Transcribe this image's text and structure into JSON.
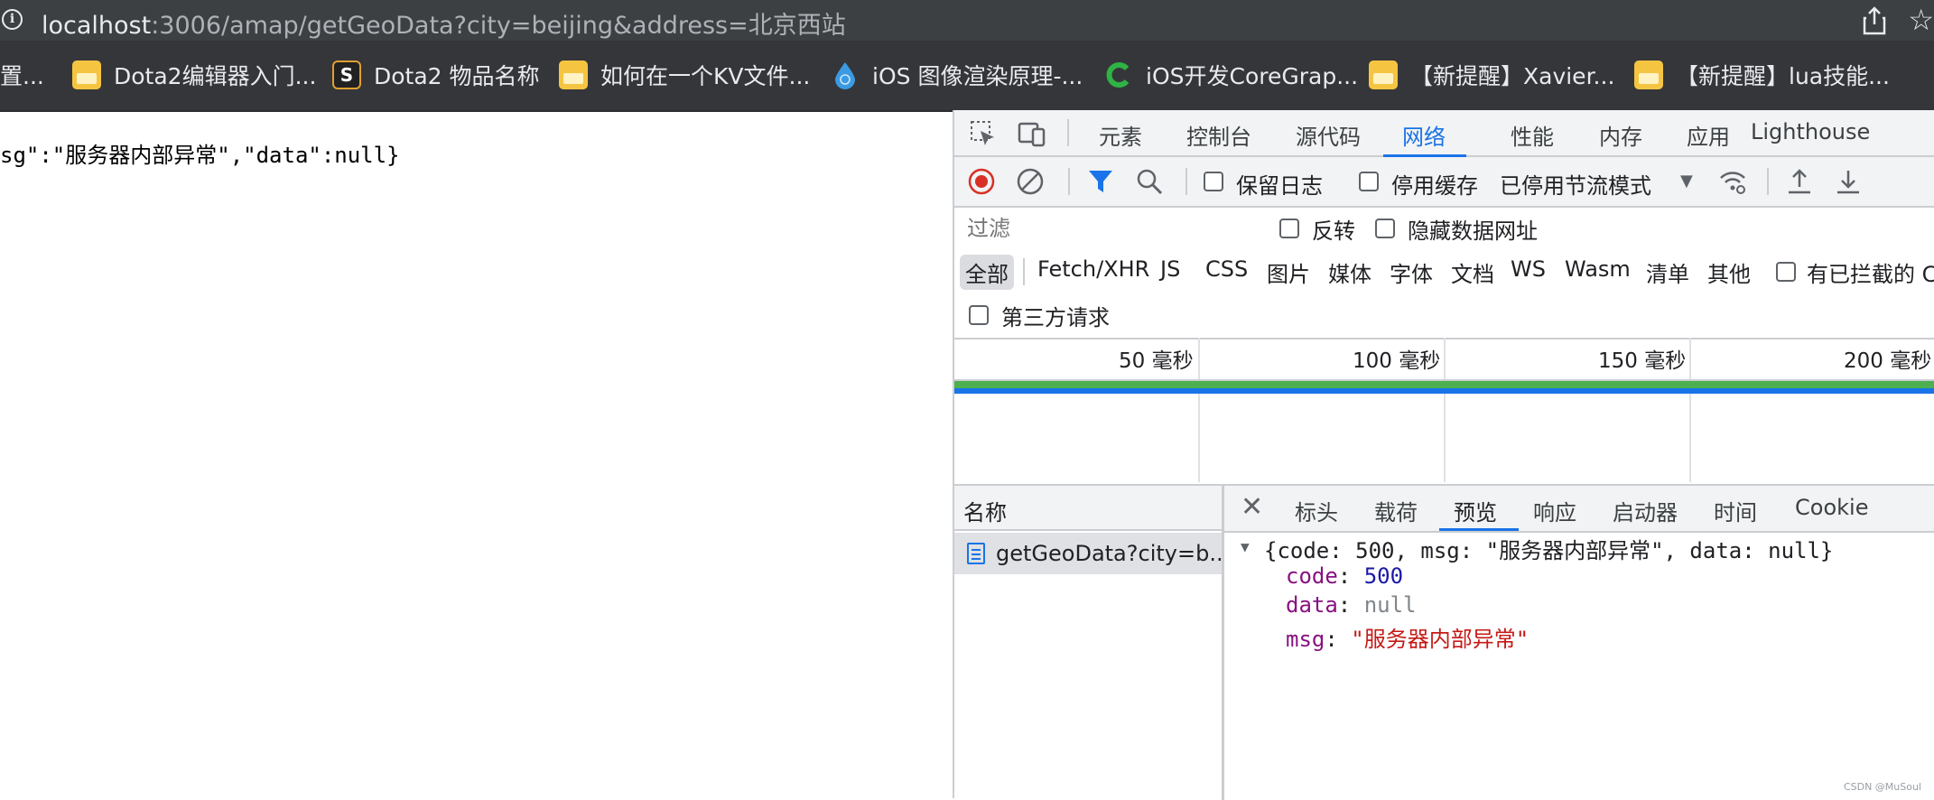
{
  "address_bar": {
    "host": "localhost",
    "path": ":3006/amap/getGeoData?city=beijing&address=北京西站"
  },
  "bookmarks": [
    {
      "label": "置...",
      "icon": "mail-icon"
    },
    {
      "label": "Dota2编辑器入门...",
      "icon": "mail-icon"
    },
    {
      "label": "Dota2 物品名称",
      "icon": "s-logo-icon"
    },
    {
      "label": "如何在一个KV文件...",
      "icon": "mail-icon"
    },
    {
      "label": "iOS 图像渲染原理-...",
      "icon": "drop-icon"
    },
    {
      "label": "iOS开发CoreGrap...",
      "icon": "c-logo-icon"
    },
    {
      "label": "【新提醒】Xavier...",
      "icon": "mail-icon"
    },
    {
      "label": "【新提醒】lua技能...",
      "icon": "mail-icon"
    }
  ],
  "page": {
    "body_text": "sg\":\"服务器内部异常\",\"data\":null}"
  },
  "devtools": {
    "tabs": [
      "元素",
      "控制台",
      "源代码",
      "网络",
      "性能",
      "内存",
      "应用",
      "Lighthouse"
    ],
    "active_tab": "网络",
    "toolbar": {
      "preserve_log": "保留日志",
      "disable_cache": "停用缓存",
      "throttling": "已停用节流模式"
    },
    "filter": {
      "placeholder": "过滤",
      "invert": "反转",
      "hide_data_urls": "隐藏数据网址"
    },
    "types": [
      "全部",
      "Fetch/XHR",
      "JS",
      "CSS",
      "图片",
      "媒体",
      "字体",
      "文档",
      "WS",
      "Wasm",
      "清单",
      "其他"
    ],
    "blocked_cookies": "有已拦截的 C",
    "third_party": "第三方请求",
    "timeline_ticks": [
      "50 毫秒",
      "100 毫秒",
      "150 毫秒",
      "200 毫秒"
    ],
    "name_header": "名称",
    "request_name": "getGeoData?city=b...",
    "detail_tabs": [
      "标头",
      "载荷",
      "预览",
      "响应",
      "启动器",
      "时间",
      "Cookie"
    ],
    "active_detail_tab": "预览",
    "preview": {
      "summary": "{code: 500, msg: \"服务器内部异常\", data: null}",
      "fields": [
        {
          "key": "code",
          "value": "500",
          "kind": "number"
        },
        {
          "key": "data",
          "value": "null",
          "kind": "null"
        },
        {
          "key": "msg",
          "value": "\"服务器内部异常\"",
          "kind": "string"
        }
      ]
    }
  },
  "watermark": "CSDN @MuSoul",
  "colors": {
    "accent": "#1a73e8",
    "record_red": "#d93025",
    "key_purple": "#881280",
    "string_red": "#c41a16",
    "number_blue": "#1a1aa6"
  }
}
